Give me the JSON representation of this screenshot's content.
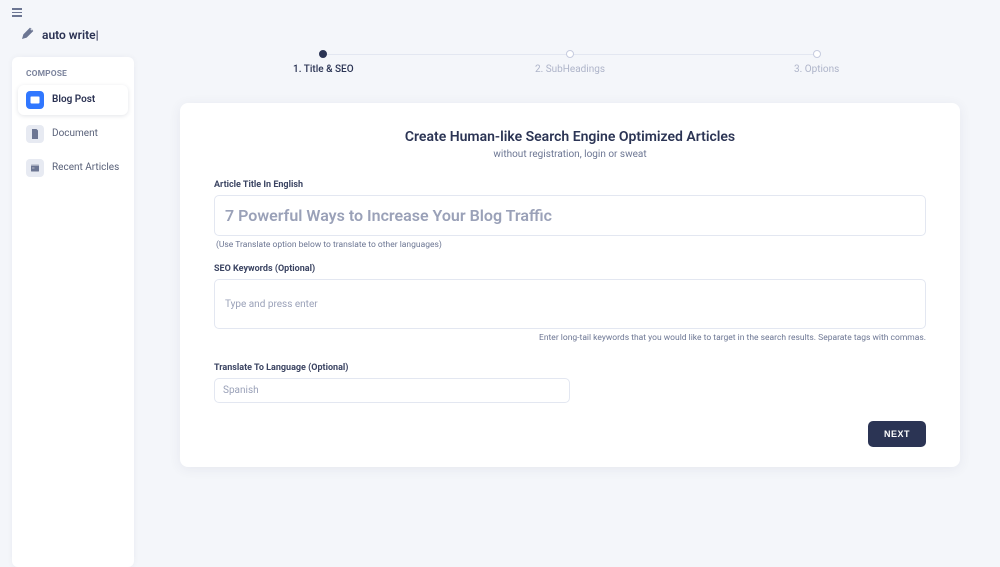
{
  "brand": {
    "name": "auto write|"
  },
  "sidebar": {
    "section": "COMPOSE",
    "items": [
      {
        "label": "Blog Post"
      },
      {
        "label": "Document"
      },
      {
        "label": "Recent Articles"
      }
    ]
  },
  "stepper": {
    "steps": [
      {
        "label": "1. Title & SEO"
      },
      {
        "label": "2. SubHeadings"
      },
      {
        "label": "3. Options"
      }
    ]
  },
  "form": {
    "heading": "Create Human-like Search Engine Optimized Articles",
    "subheading": "without registration, login or sweat",
    "title_label": "Article Title In English",
    "title_placeholder": "7 Powerful Ways to Increase Your Blog Traffic",
    "title_hint": "(Use Translate option below to translate to other languages)",
    "keywords_label": "SEO Keywords (Optional)",
    "keywords_placeholder": "Type and press enter",
    "keywords_hint": "Enter long-tail keywords that you would like to target in the search results. Separate tags with commas.",
    "lang_label": "Translate To Language (Optional)",
    "lang_placeholder": "Spanish",
    "next_button": "NEXT"
  }
}
